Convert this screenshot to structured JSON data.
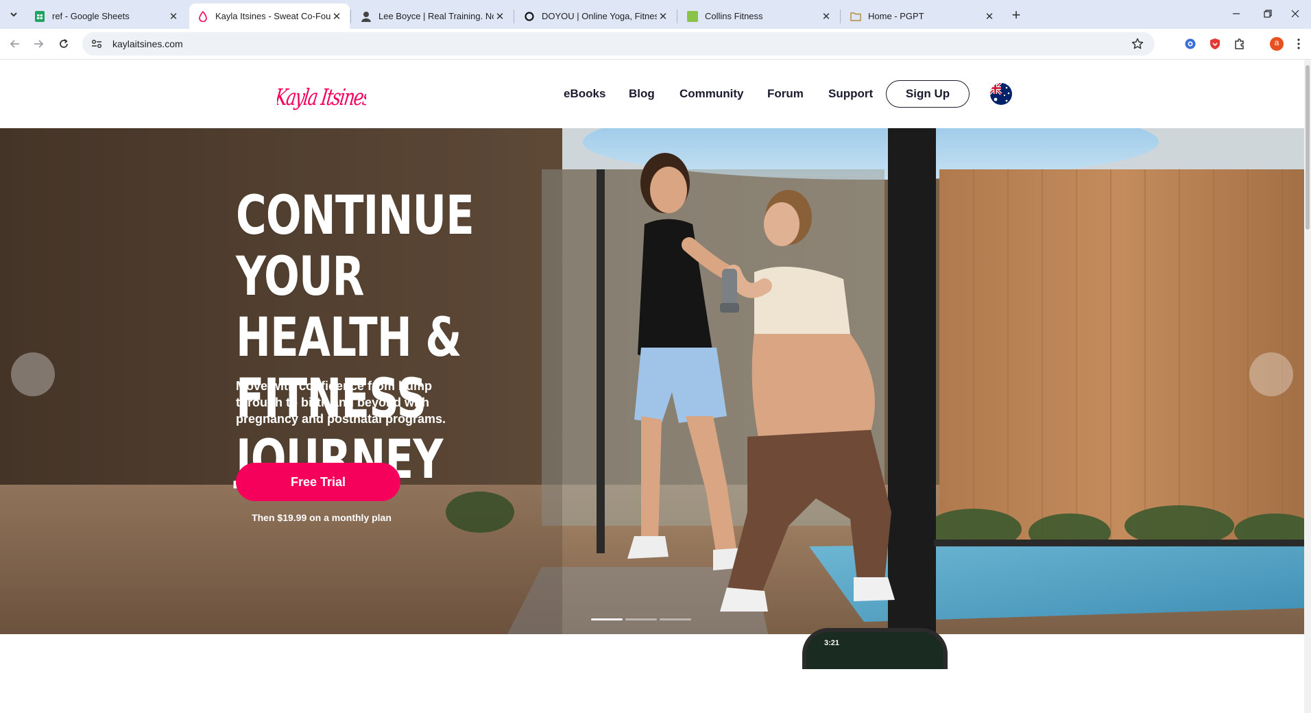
{
  "browser": {
    "tabs": [
      {
        "title": "ref - Google Sheets",
        "icon": "sheets-icon",
        "active": false
      },
      {
        "title": "Kayla Itsines - Sweat Co-Founder",
        "icon": "kayla-drop-icon",
        "active": true
      },
      {
        "title": "Lee Boyce | Real Training. No N",
        "icon": "lee-boyce-avatar-icon",
        "active": false
      },
      {
        "title": "DOYOU | Online Yoga, Fitness, a",
        "icon": "doyou-circle-icon",
        "active": false
      },
      {
        "title": "Collins Fitness",
        "icon": "collins-square-icon",
        "active": false
      },
      {
        "title": "Home - PGPT",
        "icon": "folder-icon",
        "active": false
      }
    ],
    "url": "kaylaitsines.com",
    "profile_initial": "a",
    "colors": {
      "tabstrip": "#dfe7f7",
      "omnibox": "#eef1f6"
    }
  },
  "site": {
    "logo_text": "Kayla Itsines",
    "nav": [
      "eBooks",
      "Blog",
      "Community",
      "Forum",
      "Support"
    ],
    "signup_label": "Sign Up",
    "region_flag": "australia-flag-icon",
    "brand_color": "#f5005a"
  },
  "hero": {
    "title_lines": [
      "CONTINUE YOUR",
      "HEALTH & FITNESS",
      "JOURNEY"
    ],
    "subtitle": "Move with confidence from bump through to birth and beyond with pregnancy and postnatal programs.",
    "cta_label": "Free Trial",
    "price_note": "Then $19.99 on a monthly plan",
    "slides": 3,
    "active_slide": 0
  },
  "phone_preview": {
    "status_time": "3:21"
  }
}
